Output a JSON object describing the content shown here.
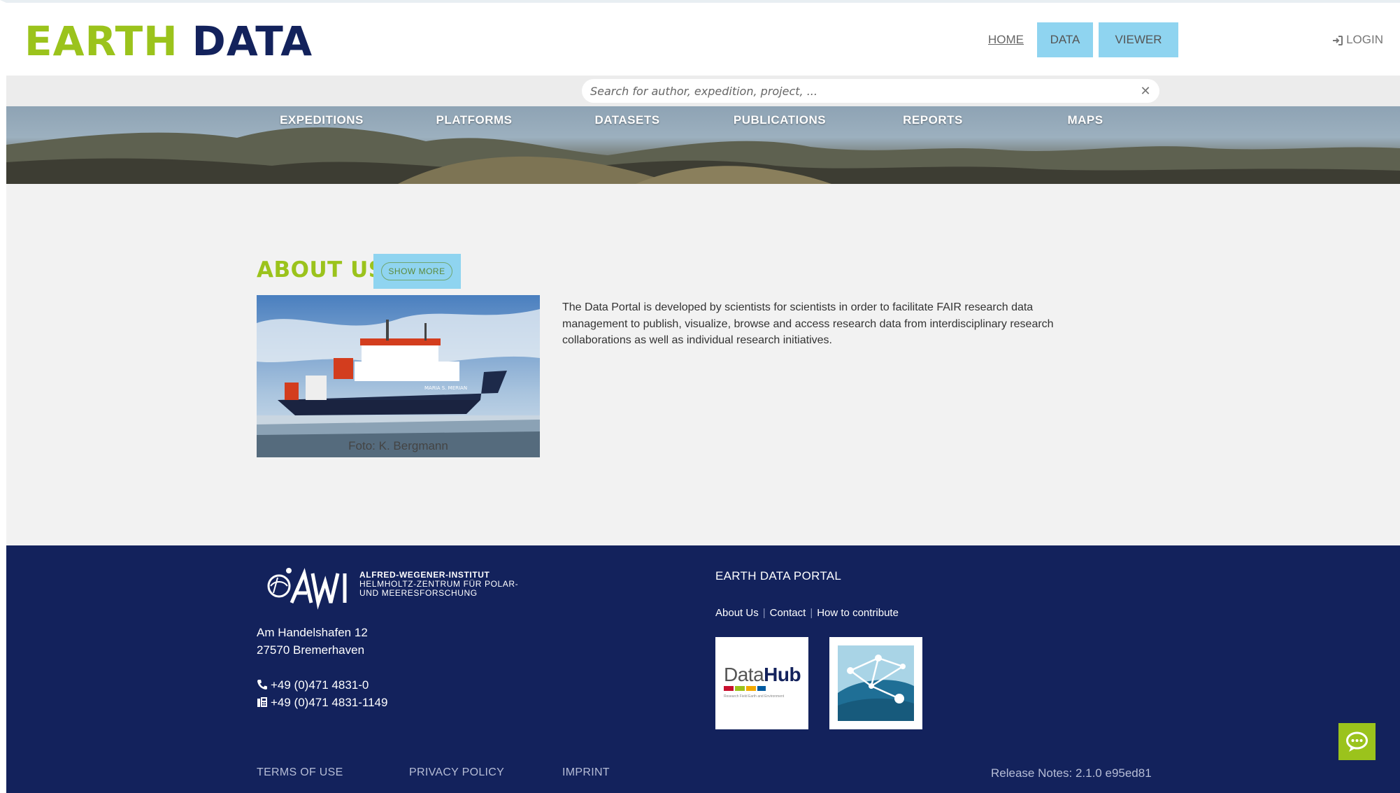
{
  "header": {
    "logo_earth": "EARTH",
    "logo_data": "DATA",
    "nav": {
      "home": "HOME",
      "data": "DATA",
      "viewer": "VIEWER"
    },
    "login": "LOGIN"
  },
  "search": {
    "placeholder": "Search for author, expedition, project, ...",
    "value": "",
    "clear_icon": "close-icon"
  },
  "categories": [
    "EXPEDITIONS",
    "PLATFORMS",
    "DATASETS",
    "PUBLICATIONS",
    "REPORTS",
    "MAPS"
  ],
  "about": {
    "title": "ABOUT US",
    "show_more": "SHOW MORE",
    "photo_caption": "Foto: K. Bergmann",
    "ship_name": "MARIA S. MERIAN",
    "text": "The Data Portal is developed by scientists for scientists in order to facilitate FAIR research data management to publish, visualize, browse and access research data from interdisciplinary research collaborations as well as individual research initiatives."
  },
  "footer": {
    "institute": {
      "line1": "ALFRED-WEGENER-INSTITUT",
      "line2": "HELMHOLTZ-ZENTRUM FÜR POLAR-",
      "line3": "UND MEERESFORSCHUNG"
    },
    "address": {
      "street": "Am Handelshafen 12",
      "city": "27570 Bremerhaven"
    },
    "phone": "+49 (0)471 4831-0",
    "fax": "+49 (0)471 4831-1149",
    "portal_title": "EARTH DATA PORTAL",
    "portal_links": {
      "about": "About Us",
      "contact": "Contact",
      "contribute": "How to contribute"
    },
    "datahub": {
      "name_a": "Data",
      "name_b": "Hub",
      "subtitle": "Research Field Earth and Environment"
    },
    "bottom_links": {
      "terms": "TERMS OF USE",
      "privacy": "PRIVACY POLICY",
      "imprint": "IMPRINT"
    },
    "release": "Release Notes: 2.1.0 e95ed81"
  },
  "colors": {
    "brand_green": "#9bc31c",
    "brand_navy": "#13225c",
    "nav_button": "#8fd4f0"
  }
}
